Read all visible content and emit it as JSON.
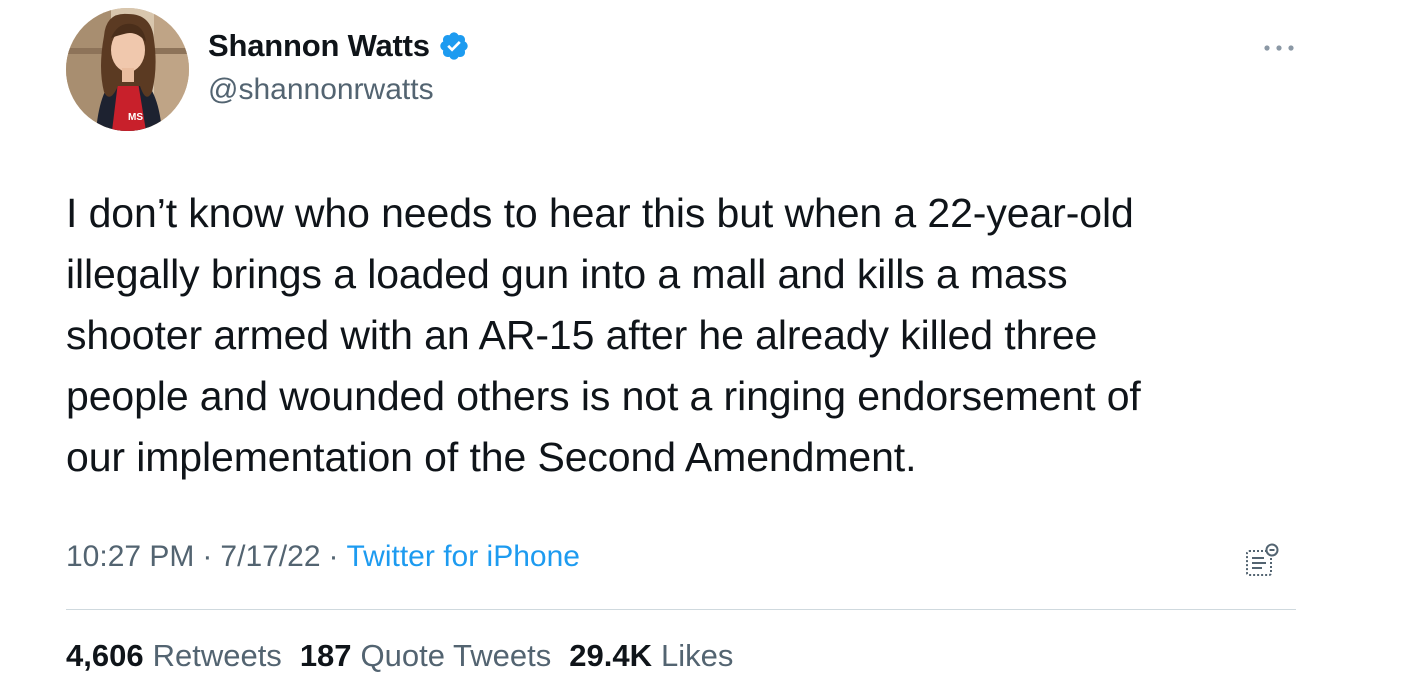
{
  "author": {
    "display_name": "Shannon Watts",
    "handle": "@shannonrwatts",
    "verified": true,
    "avatar_shirt_text": "MS"
  },
  "tweet": {
    "text": "I don’t know who needs to hear this but when a 22-year-old\nillegally brings a loaded gun into a mall and kills a mass\nshooter armed with an AR-15 after he already killed three\npeople and wounded others is not a ringing endorsement of\nour implementation of the Second Amendment.",
    "time": "10:27 PM",
    "date": "7/17/22",
    "source": "Twitter for iPhone",
    "separator": "·"
  },
  "stats": [
    {
      "value": "4,606",
      "label": "Retweets"
    },
    {
      "value": "187",
      "label": "Quote Tweets"
    },
    {
      "value": "29.4K",
      "label": "Likes"
    }
  ],
  "icons": {
    "verified": "verified-badge-icon",
    "more": "more-options-icon",
    "analytics": "tweet-analytics-icon"
  },
  "colors": {
    "text": "#0f1419",
    "secondary": "#536471",
    "accent": "#1d9bf0",
    "divider": "#cfd9de"
  }
}
